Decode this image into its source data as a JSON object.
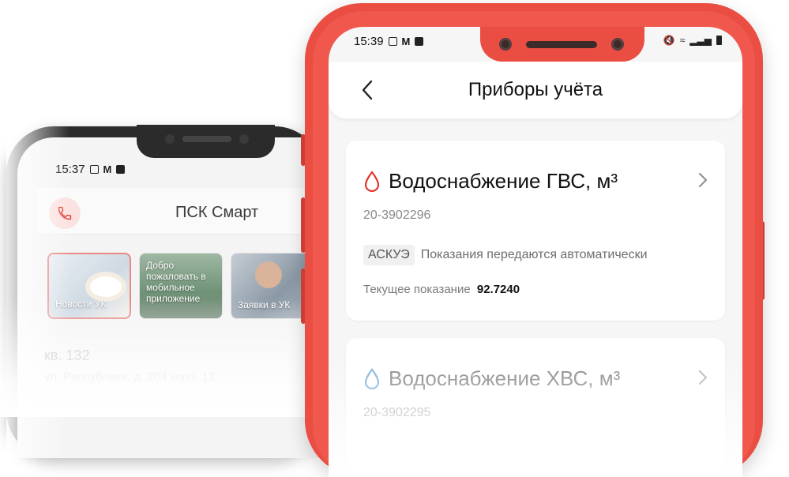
{
  "back_phone": {
    "status_time": "15:37",
    "app_title": "ПСК Смарт",
    "stories": [
      {
        "label": "Новости УК"
      },
      {
        "label": "Добро пожаловать в мобильное приложение"
      },
      {
        "label": "Заявки в УК"
      }
    ],
    "flat_number": "кв. 132",
    "address": "ул. Республики, д. 204 корп. 13"
  },
  "front_phone": {
    "status_time": "15:39",
    "page_title": "Приборы учёта",
    "meters": [
      {
        "title": "Водоснабжение ГВС, м³",
        "serial": "20-3902296",
        "tag": "АСКУЭ",
        "tag_note": "Показания передаются автоматически",
        "reading_label": "Текущее показание",
        "reading_value": "92.7240",
        "drop_color": "#e2362e"
      },
      {
        "title": "Водоснабжение ХВС, м³",
        "serial": "20-3902295",
        "drop_color": "#7fb3d9"
      }
    ]
  },
  "colors": {
    "accent_red": "#ea4e43",
    "phone_black": "#2b2b2b"
  }
}
